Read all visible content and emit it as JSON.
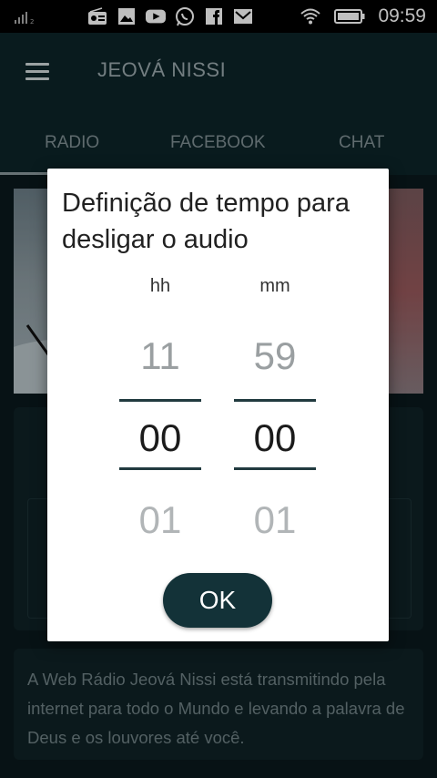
{
  "status_bar": {
    "time": "09:59",
    "icons": [
      "signal-icon",
      "radio-icon",
      "image-icon",
      "youtube-icon",
      "whatsapp-icon",
      "facebook-icon",
      "gmail-icon",
      "wifi-icon",
      "battery-icon"
    ]
  },
  "app_bar": {
    "title": "JEOVÁ NISSI"
  },
  "tabs": [
    {
      "label": "RADIO",
      "selected": true
    },
    {
      "label": "FACEBOOK",
      "selected": false
    },
    {
      "label": "CHAT",
      "selected": false
    }
  ],
  "description": "A Web Rádio Jeová Nissi está transmitindo pela internet para todo o Mundo e levando a palavra de Deus e os louvores até você.",
  "dialog": {
    "title": "Definição de tempo para desligar o audio",
    "hours": {
      "label": "hh",
      "prev": "11",
      "current": "00",
      "next": "01"
    },
    "minutes": {
      "label": "mm",
      "prev": "59",
      "current": "00",
      "next": "01"
    },
    "ok_label": "OK"
  },
  "colors": {
    "app_bar": "#0d2429",
    "ok_button": "#133238",
    "dialog_bg": "#ffffff"
  }
}
